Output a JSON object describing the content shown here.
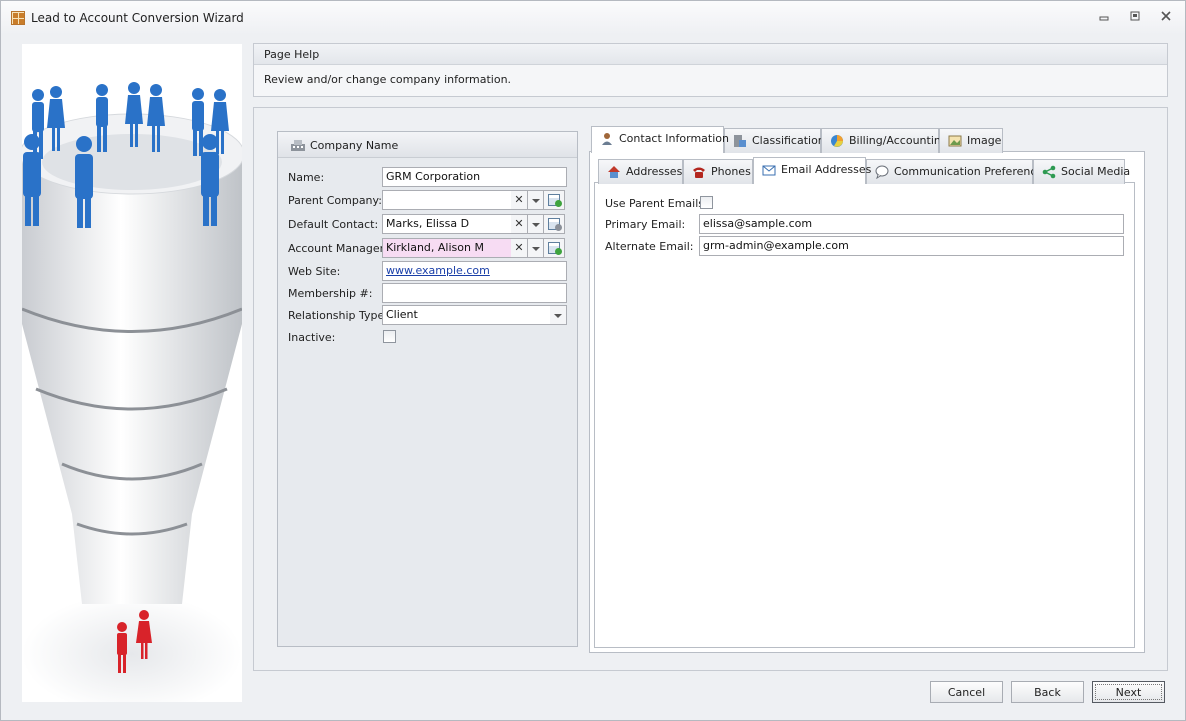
{
  "window": {
    "title": "Lead to Account Conversion Wizard"
  },
  "page_help": {
    "header": "Page Help",
    "text": "Review and/or change company information."
  },
  "company": {
    "group_title": "Company Name",
    "name_label": "Name:",
    "name_value": "GRM Corporation",
    "parent_label": "Parent Company:",
    "parent_value": "",
    "default_contact_label": "Default Contact:",
    "default_contact_value": "Marks, Elissa D",
    "manager_label": "Account Manager:",
    "manager_value": "Kirkland, Alison M",
    "website_label": "Web Site:",
    "website_value": "www.example.com",
    "membership_label": "Membership #:",
    "membership_value": "",
    "relationship_label": "Relationship Type:",
    "relationship_value": "Client",
    "inactive_label": "Inactive:"
  },
  "outer_tabs": [
    {
      "label": "Contact Information"
    },
    {
      "label": "Classification"
    },
    {
      "label": "Billing/Accounting"
    },
    {
      "label": "Image"
    }
  ],
  "inner_tabs": [
    {
      "label": "Addresses"
    },
    {
      "label": "Phones"
    },
    {
      "label": "Email Addresses"
    },
    {
      "label": "Communication Preferences"
    },
    {
      "label": "Social Media"
    }
  ],
  "email": {
    "use_parent_label": "Use Parent Emails:",
    "primary_label": "Primary Email:",
    "primary_value": "elissa@sample.com",
    "alternate_label": "Alternate Email:",
    "alternate_value": "grm-admin@example.com"
  },
  "footer": {
    "cancel": "Cancel",
    "back": "Back",
    "next": "Next"
  },
  "colors": {
    "accent_blue": "#2a72c8",
    "highlight_pink": "#f7dcf3",
    "person_red": "#d8232a"
  }
}
